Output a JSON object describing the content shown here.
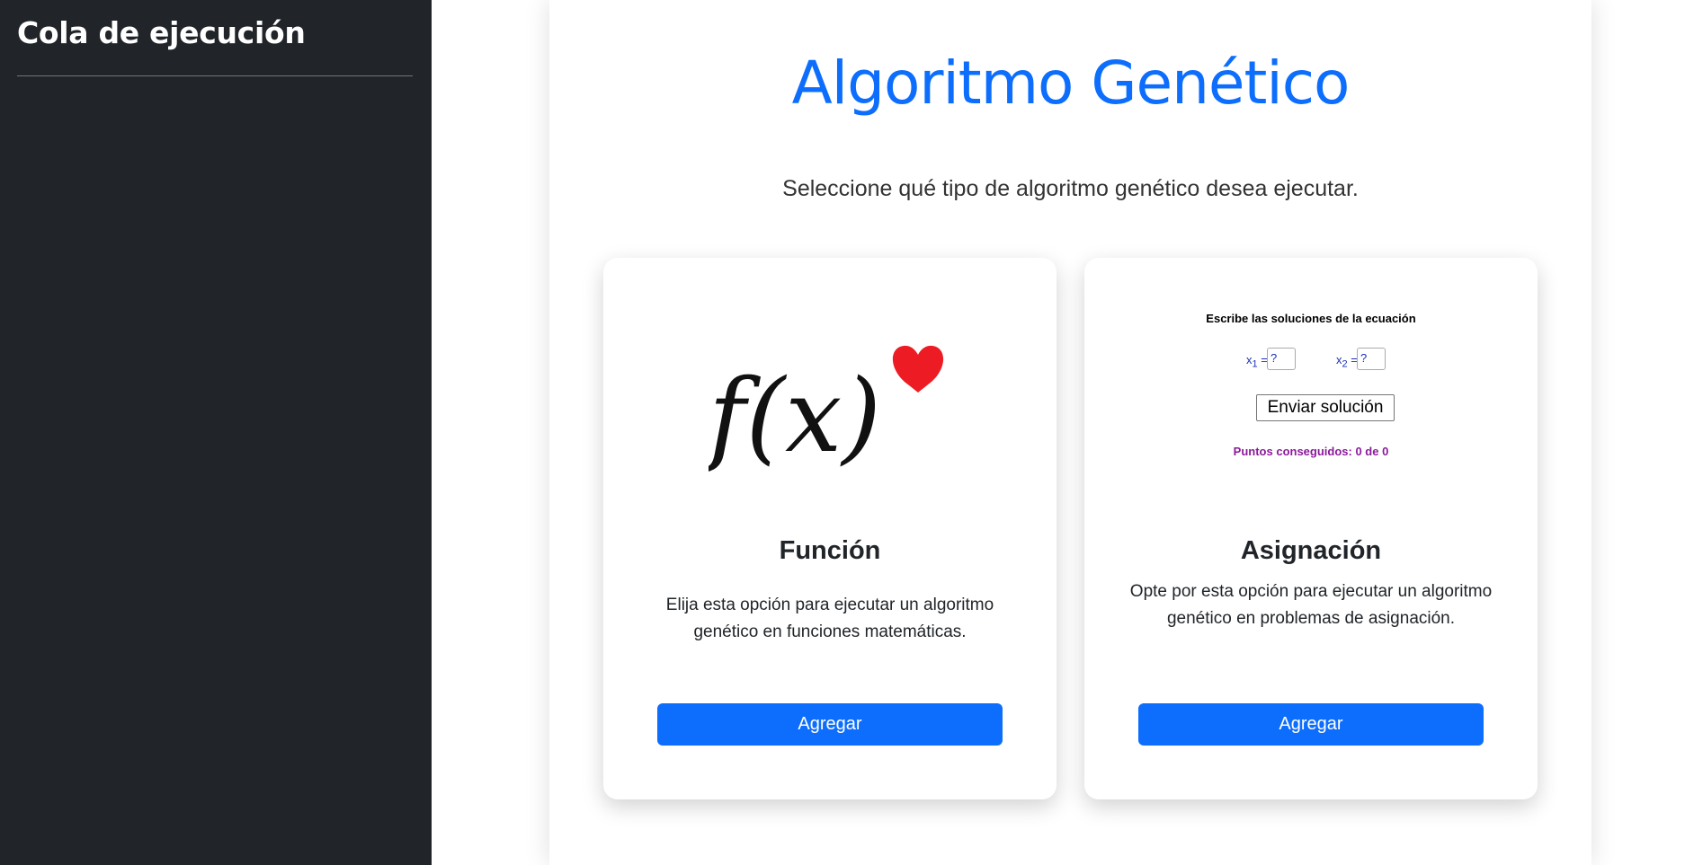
{
  "sidebar": {
    "title": "Cola de ejecución"
  },
  "main": {
    "title": "Algoritmo Genético",
    "subtitle": "Seleccione qué tipo de algoritmo genético desea ejecutar."
  },
  "cards": [
    {
      "title": "Función",
      "description": "Elija esta opción para ejecutar un algoritmo genético en funciones matemáticas.",
      "button_label": "Agregar",
      "image": {
        "icon": "fx-heart-icon",
        "formula_text": "f(x)",
        "heart_color": "#ed1c24"
      }
    },
    {
      "title": "Asignación",
      "description": "Opte por esta opción para ejecutar un algoritmo genético en problemas de asignación.",
      "button_label": "Agregar",
      "image": {
        "heading": "Escribe las soluciones de la ecuación",
        "var1": "x",
        "var1_sub": "1",
        "var2": "x",
        "var2_sub": "2",
        "equals": "=",
        "field1_value": "?",
        "field2_value": "?",
        "submit_label": "Enviar solución",
        "points_text": "Puntos conseguidos: 0 de 0"
      }
    }
  ],
  "colors": {
    "sidebar_bg": "#212529",
    "accent": "#0d6efd",
    "points": "#8b1a9b"
  }
}
